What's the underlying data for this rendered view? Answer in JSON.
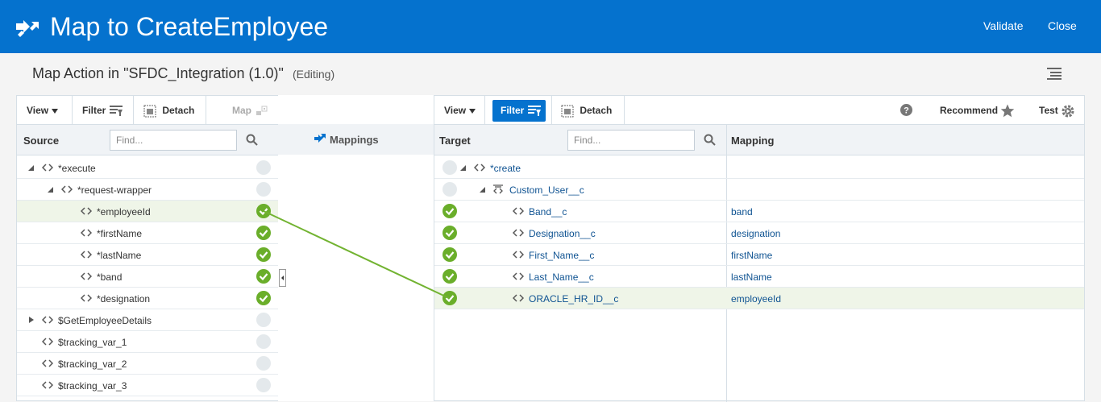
{
  "header": {
    "title": "Map to CreateEmployee",
    "validate_label": "Validate",
    "close_label": "Close",
    "brand_color": "#0572ce"
  },
  "subheader": {
    "title": "Map Action in \"SFDC_Integration (1.0)\"",
    "status": "(Editing)"
  },
  "source_panel": {
    "toolbar": {
      "view": "View",
      "filter": "Filter",
      "detach": "Detach",
      "map": "Map"
    },
    "column": "Source",
    "search_placeholder": "Find...",
    "rows": [
      {
        "label": "*execute",
        "mapped": false
      },
      {
        "label": "*request-wrapper",
        "mapped": false
      },
      {
        "label": "*employeeId",
        "mapped": true
      },
      {
        "label": "*firstName",
        "mapped": true
      },
      {
        "label": "*lastName",
        "mapped": true
      },
      {
        "label": "*band",
        "mapped": true
      },
      {
        "label": "*designation",
        "mapped": true
      },
      {
        "label": "$GetEmployeeDetails",
        "mapped": false
      },
      {
        "label": "$tracking_var_1",
        "mapped": false
      },
      {
        "label": "$tracking_var_2",
        "mapped": false
      },
      {
        "label": "$tracking_var_3",
        "mapped": false
      }
    ]
  },
  "mappings_panel": {
    "label": "Mappings"
  },
  "target_panel": {
    "toolbar": {
      "view": "View",
      "filter": "Filter",
      "detach": "Detach",
      "recommend": "Recommend",
      "test": "Test"
    },
    "columns": {
      "target": "Target",
      "mapping": "Mapping"
    },
    "search_placeholder": "Find...",
    "rows": [
      {
        "label": "*create",
        "mapping": "",
        "mapped": false
      },
      {
        "label": "Custom_User__c",
        "mapping": "",
        "mapped": false
      },
      {
        "label": "Band__c",
        "mapping": "band",
        "mapped": true
      },
      {
        "label": "Designation__c",
        "mapping": "designation",
        "mapped": true
      },
      {
        "label": "First_Name__c",
        "mapping": "firstName",
        "mapped": true
      },
      {
        "label": "Last_Name__c",
        "mapping": "lastName",
        "mapped": true
      },
      {
        "label": "ORACLE_HR_ID__c",
        "mapping": "employeeId",
        "mapped": true
      }
    ]
  },
  "colors": {
    "check_green": "#6aae2a",
    "link_line": "#72b331"
  }
}
